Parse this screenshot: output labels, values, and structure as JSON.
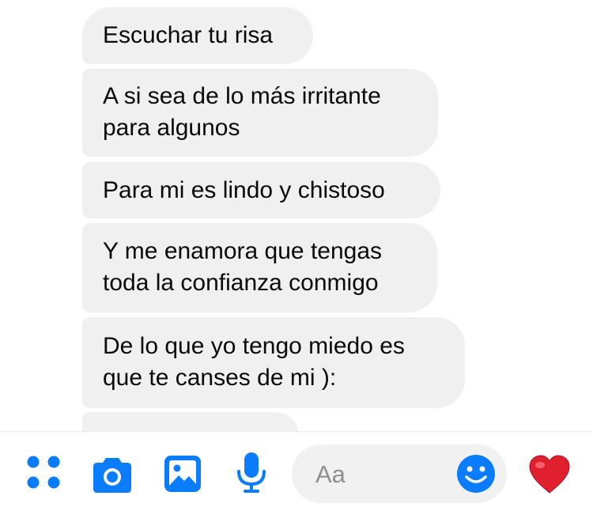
{
  "messages": [
    "Escuchar tu risa",
    "A si sea de lo más irritante\npara algunos",
    "Para mi es lindo y chistoso",
    "Y me enamora que tengas\ntoda la confianza conmigo",
    "De lo que yo tengo miedo es\nque te canses de mi ):",
    ""
  ],
  "composer": {
    "placeholder": "Aa",
    "icons": [
      "more-apps-icon",
      "camera-icon",
      "gallery-icon",
      "microphone-icon",
      "emoji-icon",
      "heart-icon"
    ]
  },
  "colors": {
    "bubble": "#f0f0f0",
    "accent": "#0a7cff",
    "heart": "#e0202e"
  }
}
